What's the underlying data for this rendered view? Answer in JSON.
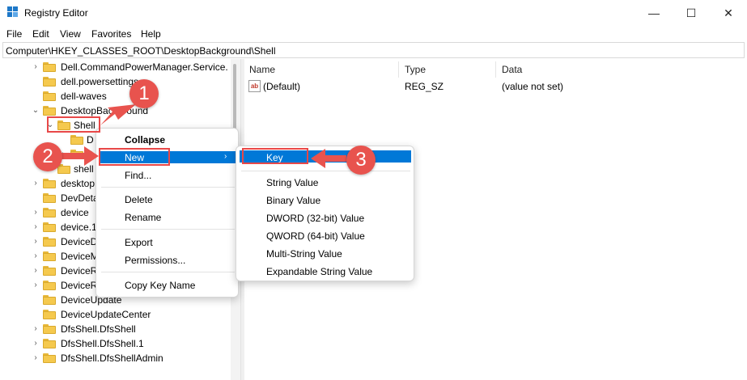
{
  "window": {
    "title": "Registry Editor",
    "minimize_glyph": "—",
    "maximize_glyph": "☐",
    "close_glyph": "✕"
  },
  "menubar": [
    "File",
    "Edit",
    "View",
    "Favorites",
    "Help"
  ],
  "address": "Computer\\HKEY_CLASSES_ROOT\\DesktopBackground\\Shell",
  "tree": [
    {
      "label": "Dell.CommandPowerManager.Service.",
      "expander": "›"
    },
    {
      "label": "dell.powersettings",
      "expander": ""
    },
    {
      "label": "dell-waves",
      "expander": ""
    },
    {
      "label": "DesktopBackground",
      "expander": "⌄"
    },
    {
      "label": "Shell",
      "expander": "⌄"
    },
    {
      "label": "D",
      "expander": ""
    },
    {
      "label": "D",
      "expander": "›"
    },
    {
      "label": "shell",
      "expander": "›"
    },
    {
      "label": "desktop",
      "expander": "›"
    },
    {
      "label": "DevDeta",
      "expander": ""
    },
    {
      "label": "device",
      "expander": "›"
    },
    {
      "label": "device.1",
      "expander": "›"
    },
    {
      "label": "DeviceD",
      "expander": "›"
    },
    {
      "label": "DeviceM",
      "expander": "›"
    },
    {
      "label": "DeviceR",
      "expander": "›"
    },
    {
      "label": "DeviceR",
      "expander": "›"
    },
    {
      "label": "DeviceUpdate",
      "expander": ""
    },
    {
      "label": "DeviceUpdateCenter",
      "expander": ""
    },
    {
      "label": "DfsShell.DfsShell",
      "expander": "›"
    },
    {
      "label": "DfsShell.DfsShell.1",
      "expander": "›"
    },
    {
      "label": "DfsShell.DfsShellAdmin",
      "expander": "›"
    }
  ],
  "list": {
    "columns": [
      "Name",
      "Type",
      "Data"
    ],
    "rows": [
      {
        "name": "(Default)",
        "type": "REG_SZ",
        "data": "(value not set)",
        "icon": "ab"
      }
    ]
  },
  "context_menu": {
    "items": [
      "Collapse",
      "New",
      "Find...",
      "Delete",
      "Rename",
      "Export",
      "Permissions...",
      "Copy Key Name"
    ],
    "submenu_arrow": "›"
  },
  "submenu": {
    "items": [
      "Key",
      "String Value",
      "Binary Value",
      "DWORD (32-bit) Value",
      "QWORD (64-bit) Value",
      "Multi-String Value",
      "Expandable String Value"
    ]
  },
  "callouts": [
    "1",
    "2",
    "3"
  ],
  "colors": {
    "accent": "#0078d7",
    "callout": "#e8534e",
    "highlight_box": "#e84848",
    "folder": "#f5c94e"
  }
}
